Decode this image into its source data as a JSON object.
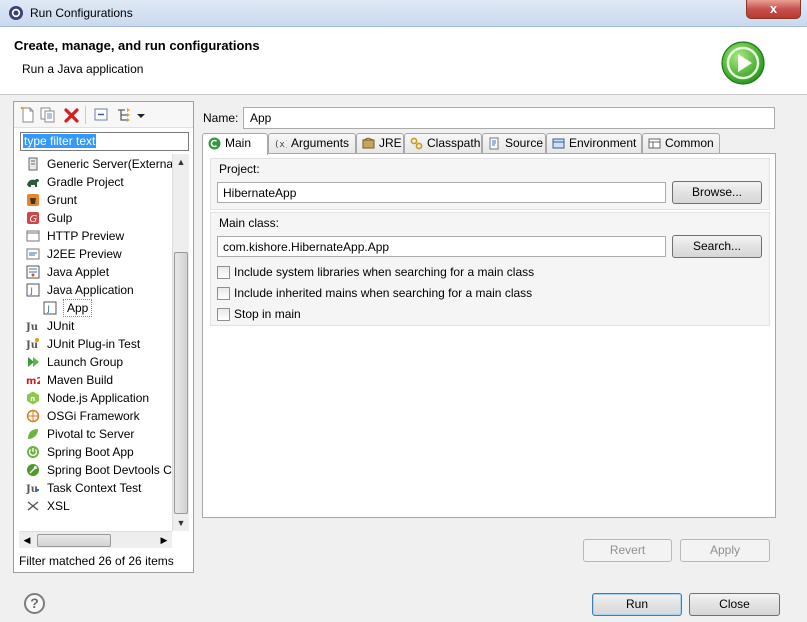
{
  "window": {
    "title": "Run Configurations",
    "close_glyph": "x"
  },
  "header": {
    "title": "Create, manage, and run configurations",
    "subtitle": "Run a Java application",
    "icon": "run-green-circle-icon"
  },
  "left_panel": {
    "filter_placeholder": "type filter text",
    "tree": [
      {
        "label": "Generic Server(External",
        "icon": "generic-server-icon"
      },
      {
        "label": "Gradle Project",
        "icon": "gradle-icon"
      },
      {
        "label": "Grunt",
        "icon": "grunt-icon"
      },
      {
        "label": "Gulp",
        "icon": "gulp-icon"
      },
      {
        "label": "HTTP Preview",
        "icon": "http-preview-icon"
      },
      {
        "label": "J2EE Preview",
        "icon": "j2ee-preview-icon"
      },
      {
        "label": "Java Applet",
        "icon": "java-applet-icon"
      },
      {
        "label": "Java Application",
        "icon": "java-application-icon"
      },
      {
        "label": "App",
        "icon": "java-app-config-icon",
        "child": true,
        "selected": true
      },
      {
        "label": "JUnit",
        "icon": "junit-icon"
      },
      {
        "label": "JUnit Plug-in Test",
        "icon": "junit-plugin-icon"
      },
      {
        "label": "Launch Group",
        "icon": "launch-group-icon"
      },
      {
        "label": "Maven Build",
        "icon": "maven-icon"
      },
      {
        "label": "Node.js Application",
        "icon": "nodejs-icon"
      },
      {
        "label": "OSGi Framework",
        "icon": "osgi-icon"
      },
      {
        "label": "Pivotal tc Server",
        "icon": "pivotal-icon"
      },
      {
        "label": "Spring Boot App",
        "icon": "spring-boot-icon"
      },
      {
        "label": "Spring Boot Devtools Cl",
        "icon": "spring-devtools-icon"
      },
      {
        "label": "Task Context Test",
        "icon": "task-context-icon"
      },
      {
        "label": "XSL",
        "icon": "xsl-icon"
      }
    ],
    "filter_status": "Filter matched 26 of 26 items"
  },
  "config": {
    "name_label": "Name:",
    "name_value": "App",
    "tabs": [
      {
        "label": "Main",
        "icon": "main-tab-icon",
        "active": true
      },
      {
        "label": "Arguments",
        "icon": "arguments-icon"
      },
      {
        "label": "JRE",
        "icon": "jre-icon"
      },
      {
        "label": "Classpath",
        "icon": "classpath-icon"
      },
      {
        "label": "Source",
        "icon": "source-icon"
      },
      {
        "label": "Environment",
        "icon": "environment-icon"
      },
      {
        "label": "Common",
        "icon": "common-icon"
      }
    ],
    "project_label": "Project:",
    "project_value": "HibernateApp",
    "browse_label": "Browse...",
    "main_class_label": "Main class:",
    "main_class_value": "com.kishore.HibernateApp.App",
    "search_label": "Search...",
    "checkboxes": [
      {
        "label": "Include system libraries when searching for a main class",
        "checked": false
      },
      {
        "label": "Include inherited mains when searching for a main class",
        "checked": false
      },
      {
        "label": "Stop in main",
        "checked": false
      }
    ],
    "revert_label": "Revert",
    "apply_label": "Apply"
  },
  "footer": {
    "help_glyph": "?",
    "run_label": "Run",
    "close_label": "Close"
  }
}
